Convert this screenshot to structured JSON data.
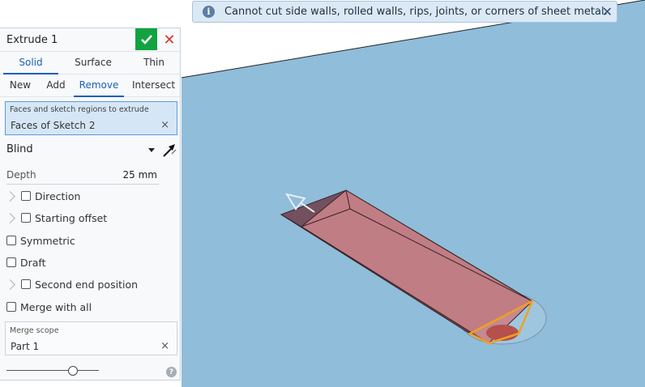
{
  "toast": {
    "message": "Cannot cut side walls, rolled walls, rips, joints, or corners of sheet metal.",
    "icon": "info-icon",
    "close_icon": "close-icon"
  },
  "panel": {
    "title": "Extrude 1",
    "ok_icon": "checkmark-icon",
    "cancel_icon": "close-icon",
    "type_tabs": [
      {
        "label": "Solid",
        "active": true
      },
      {
        "label": "Surface",
        "active": false
      },
      {
        "label": "Thin",
        "active": false
      }
    ],
    "operation_tabs": [
      {
        "label": "New",
        "active": false
      },
      {
        "label": "Add",
        "active": false
      },
      {
        "label": "Remove",
        "active": true
      },
      {
        "label": "Intersect",
        "active": false
      }
    ],
    "faces": {
      "label": "Faces and sketch regions to extrude",
      "value": "Faces of Sketch 2",
      "clear": "×"
    },
    "end_type": {
      "value": "Blind"
    },
    "depth": {
      "label": "Depth",
      "value": "25 mm"
    },
    "options": {
      "direction": "Direction",
      "starting_offset": "Starting offset",
      "symmetric": "Symmetric",
      "draft": "Draft",
      "second_end_position": "Second end position",
      "merge_with_all": "Merge with all"
    },
    "merge_scope": {
      "label": "Merge scope",
      "value": "Part 1",
      "clear": "×"
    },
    "slider": {
      "level": 0.72
    },
    "help": "?"
  },
  "colors": {
    "viewport_bg": "#8fbdda",
    "accent": "#1c5fb8",
    "ok_green": "#12a340",
    "cancel_red": "#d33a2c",
    "part_face": "#a86a6f",
    "highlight_edge": "#f0a020"
  }
}
